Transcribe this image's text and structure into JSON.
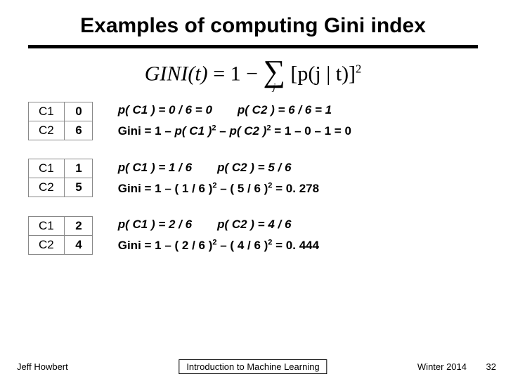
{
  "title": "Examples of computing Gini index",
  "formula": {
    "lhs": "GINI(t)",
    "rhs_before_sum": "1",
    "sum_index": "j",
    "inside": "[p(j | t)]",
    "power": "2"
  },
  "examples": [
    {
      "table": [
        [
          "C1",
          "0"
        ],
        [
          "C2",
          "6"
        ]
      ],
      "p1": "p( C1 ) = 0 / 6 = 0",
      "p2": "p( C2 ) = 6 / 6 = 1",
      "gini_pre": "Gini = 1 – ",
      "gini_t1": "p( C1 )",
      "gini_t2": "p( C2 )",
      "gini_post": " = 1 – 0 – 1 = 0"
    },
    {
      "table": [
        [
          "C1",
          "1"
        ],
        [
          "C2",
          "5"
        ]
      ],
      "p1": "p( C1 ) = 1 / 6",
      "p2": "p( C2 ) = 5 / 6",
      "gini_full": "Gini = 1 – ( 1 / 6 )",
      "gini_mid": " – ( 5 / 6 )",
      "gini_post": " = 0. 278"
    },
    {
      "table": [
        [
          "C1",
          "2"
        ],
        [
          "C2",
          "4"
        ]
      ],
      "p1": "p( C1 ) = 2 / 6",
      "p2": "p( C2 ) = 4 / 6",
      "gini_full": "Gini = 1 – ( 2 / 6 )",
      "gini_mid": " – ( 4 / 6 )",
      "gini_post": " = 0. 444"
    }
  ],
  "footer": {
    "author": "Jeff Howbert",
    "course": "Introduction to Machine Learning",
    "term": "Winter 2014",
    "page": "32"
  }
}
